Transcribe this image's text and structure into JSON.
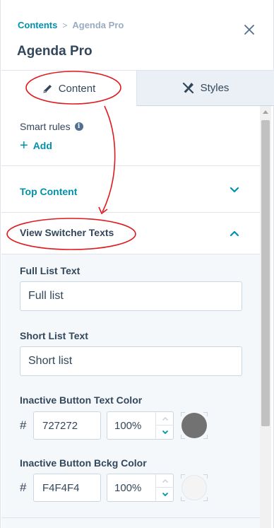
{
  "breadcrumb": {
    "parent": "Contents",
    "separator": ">",
    "current": "Agenda Pro"
  },
  "header": {
    "title": "Agenda Pro"
  },
  "tabs": [
    {
      "label": "Content",
      "icon": "pencil-icon",
      "active": true
    },
    {
      "label": "Styles",
      "icon": "brush-icon",
      "active": false
    }
  ],
  "smart_rules": {
    "label": "Smart rules",
    "add_label": "Add"
  },
  "sections": {
    "top_content": {
      "title": "Top Content",
      "expanded": false
    },
    "view_switcher": {
      "title": "View Switcher Texts",
      "expanded": true
    }
  },
  "fields": {
    "full_list": {
      "label": "Full List Text",
      "value": "Full list"
    },
    "short_list": {
      "label": "Short List Text",
      "value": "Short list"
    },
    "inactive_text_color": {
      "label": "Inactive Button Text Color",
      "hash": "#",
      "hex": "727272",
      "opacity": "100%",
      "swatch_color": "#727272"
    },
    "inactive_bg_color": {
      "label": "Inactive Button Bckg Color",
      "hash": "#",
      "hex": "F4F4F4",
      "opacity": "100%",
      "swatch_color": "#F4F4F4"
    }
  },
  "colors": {
    "accent": "#0091ae",
    "text": "#33475b",
    "annotation": "#e0191f"
  }
}
